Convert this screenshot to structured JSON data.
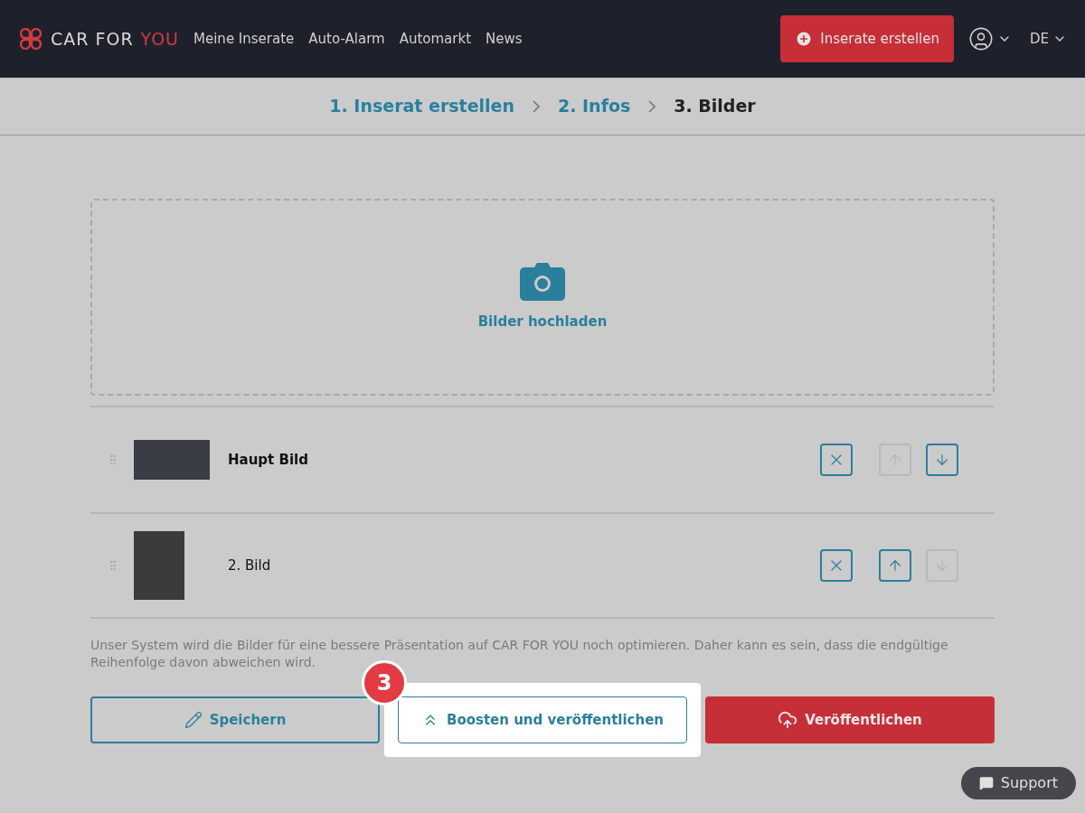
{
  "header": {
    "logo": {
      "text": "CAR FOR",
      "accent": "YOU"
    },
    "nav": [
      "Meine Inserate",
      "Auto-Alarm",
      "Automarkt",
      "News"
    ],
    "create_button": "Inserate erstellen",
    "language": "DE"
  },
  "steps": [
    {
      "label": "1. Inserat erstellen",
      "selected": false
    },
    {
      "label": "2. Infos",
      "selected": false
    },
    {
      "label": "3. Bilder",
      "selected": true
    }
  ],
  "upload": {
    "label": "Bilder hochladen"
  },
  "images": [
    {
      "title": "Haupt Bild",
      "kind": "main",
      "up_disabled": true,
      "down_disabled": false
    },
    {
      "title": "2. Bild",
      "kind": "normal",
      "up_disabled": false,
      "down_disabled": true
    }
  ],
  "note": "Unser System wird die Bilder für eine bessere Präsentation auf CAR FOR YOU noch optimieren. Daher kann es sein, dass die endgültige Reihenfolge davon abweichen wird.",
  "actions": {
    "save": "Speichern",
    "boost": "Boosten und veröffentlichen",
    "publish": "Veröffentlichen"
  },
  "tour_step": "3",
  "support": "Support"
}
